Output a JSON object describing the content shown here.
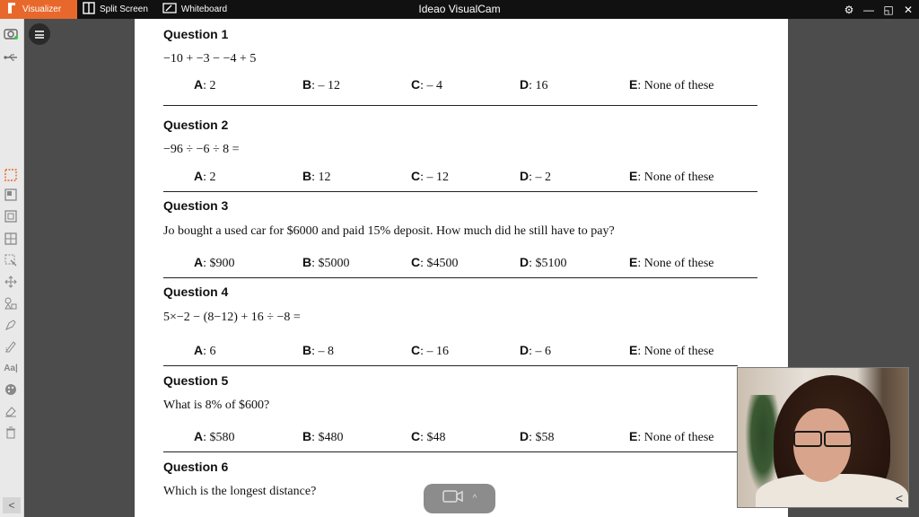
{
  "app": {
    "title": "Ideao VisualCam",
    "tabs": [
      {
        "label": "Visualizer",
        "active": true
      },
      {
        "label": "Split Screen",
        "active": false
      },
      {
        "label": "Whiteboard",
        "active": false
      }
    ]
  },
  "colors": {
    "accent": "#e8682c",
    "topbar": "#111111"
  },
  "worksheet": {
    "questions": [
      {
        "title": "Question 1",
        "text": "−10 + −3 − −4 + 5",
        "options": [
          [
            "A",
            ": 2"
          ],
          [
            "B",
            ": – 12"
          ],
          [
            "C",
            ": – 4"
          ],
          [
            "D",
            ": 16"
          ],
          [
            "E",
            ": None of these"
          ]
        ]
      },
      {
        "title": "Question 2",
        "text": "−96 ÷ −6 ÷ 8 =",
        "options": [
          [
            "A",
            ": 2"
          ],
          [
            "B",
            ": 12"
          ],
          [
            "C",
            ": – 12"
          ],
          [
            "D",
            ": – 2"
          ],
          [
            "E",
            ": None of these"
          ]
        ]
      },
      {
        "title": "Question 3",
        "text": "Jo bought a used car for $6000 and paid 15% deposit. How much did he still have to pay?",
        "options": [
          [
            "A",
            ": $900"
          ],
          [
            "B",
            ": $5000"
          ],
          [
            "C",
            ": $4500"
          ],
          [
            "D",
            ": $5100"
          ],
          [
            "E",
            ": None of these"
          ]
        ]
      },
      {
        "title": "Question 4",
        "text": "5×−2 − (8−12) + 16 ÷ −8 =",
        "options": [
          [
            "A",
            ": 6"
          ],
          [
            "B",
            ": – 8"
          ],
          [
            "C",
            ": – 16"
          ],
          [
            "D",
            ": – 6"
          ],
          [
            "E",
            ": None of these"
          ]
        ]
      },
      {
        "title": "Question 5",
        "text": "What is 8% of $600?",
        "options": [
          [
            "A",
            ": $580"
          ],
          [
            "B",
            ": $480"
          ],
          [
            "C",
            ": $48"
          ],
          [
            "D",
            ": $58"
          ],
          [
            "E",
            ": None of these"
          ]
        ]
      },
      {
        "title": "Question 6",
        "text": "Which is the longest distance?",
        "options": []
      }
    ]
  },
  "icons": {
    "left_toolbar": [
      "camera-icon",
      "usb-icon",
      "select-rect-icon",
      "freeze-icon",
      "crop-icon",
      "grid-icon",
      "pointer-icon",
      "move-icon",
      "shapes-icon",
      "highlighter-icon",
      "pen-icon",
      "text-icon",
      "palette-icon",
      "eraser-icon",
      "trash-icon"
    ]
  }
}
